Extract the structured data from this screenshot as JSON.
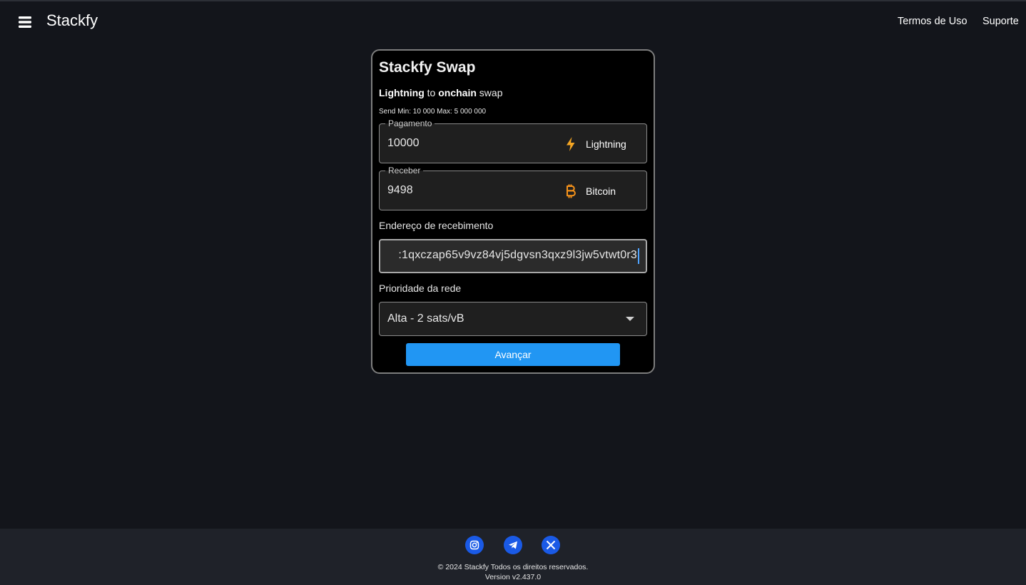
{
  "header": {
    "brand": "Stackfy",
    "nav": {
      "terms": "Termos de Uso",
      "support": "Suporte"
    }
  },
  "swap": {
    "title": "Stackfy Swap",
    "subtitle": {
      "from": "Lightning",
      "connector": "to",
      "to": "onchain",
      "suffix": "swap"
    },
    "limits": "Send Min: 10 000 Max: 5 000 000",
    "pay": {
      "legend": "Pagamento",
      "value": "10000",
      "asset": "Lightning",
      "icon": "lightning-bolt-icon",
      "icon_color": "#f5a623"
    },
    "receive": {
      "legend": "Receber",
      "value": "9498",
      "asset": "Bitcoin",
      "icon": "bitcoin-icon",
      "icon_color": "#f7931a"
    },
    "address": {
      "label": "Endereço de recebimento",
      "value": ":1qxczap65v9vz84vj5dgvsn3qxz9l3jw5vtwt0r3"
    },
    "priority": {
      "label": "Prioridade da rede",
      "selected": "Alta - 2 sats/vB"
    },
    "submit_label": "Avançar"
  },
  "footer": {
    "social": [
      "instagram-icon",
      "telegram-icon",
      "x-icon"
    ],
    "copyright": "© 2024 Stackfy Todos os direitos reservados.",
    "version": "Version v2.437.0"
  },
  "colors": {
    "background": "#13151b",
    "card": "#000000",
    "accent": "#2196f3",
    "footer": "#1f2229",
    "social": "#1a5ae6"
  }
}
